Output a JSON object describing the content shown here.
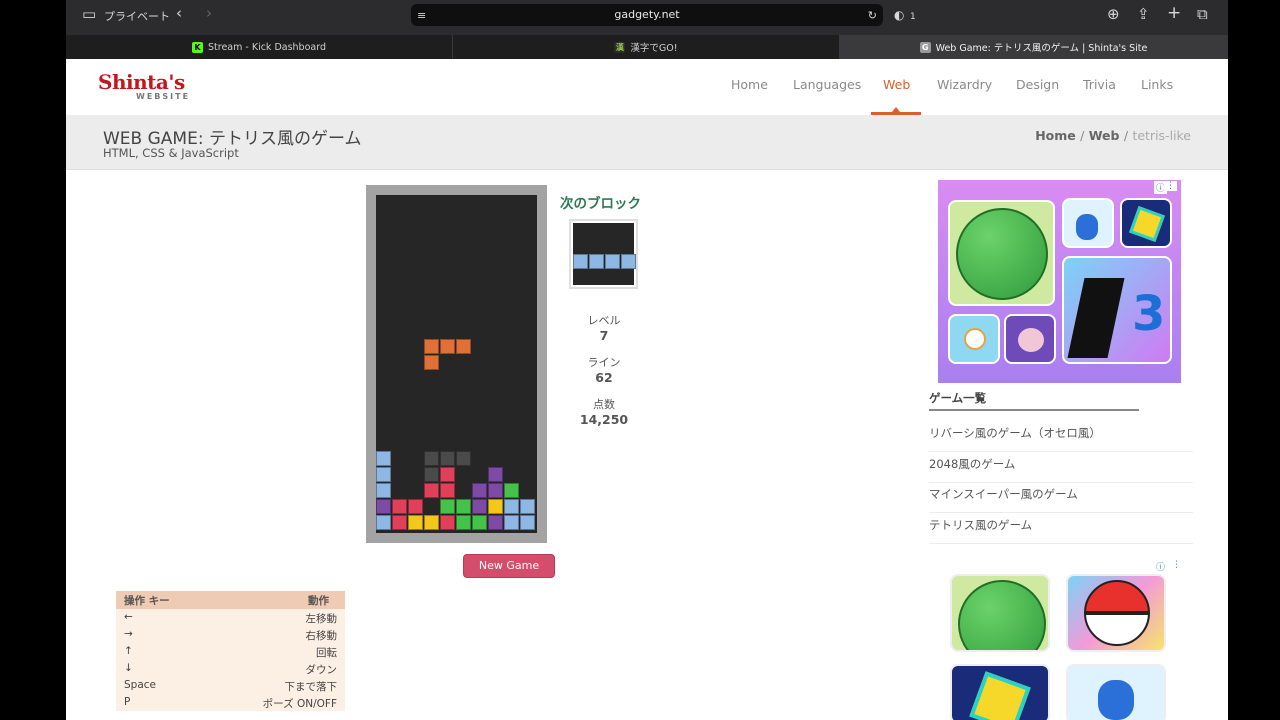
{
  "browser": {
    "private_label": "プライベート",
    "url": "gadgety.net",
    "shield_count": "1",
    "tabs": [
      {
        "title": "Stream - Kick Dashboard",
        "favicon": "K",
        "favicon_color": "#53fc18"
      },
      {
        "title": "漢字でGO!",
        "favicon": "漢",
        "favicon_color": "#9acd32"
      },
      {
        "title": "Web Game: テトリス風のゲーム | Shinta's Site",
        "favicon": "G",
        "favicon_color": "#9a9a9a"
      }
    ]
  },
  "site": {
    "logo_main": "Shinta's",
    "logo_sub": "WEBSITE",
    "nav": [
      "Home",
      "Languages",
      "Web",
      "Wizardry",
      "Design",
      "Trivia",
      "Links"
    ],
    "nav_active": "Web",
    "accent_color": "#d95f2b"
  },
  "page": {
    "title": "WEB GAME: テトリス風のゲーム",
    "subtitle": "HTML, CSS & JavaScript",
    "breadcrumb": {
      "home": "Home",
      "section": "Web",
      "current": "tetris-like",
      "sep": "/"
    }
  },
  "game": {
    "next_label": "次のブロック",
    "level_label": "レベル",
    "level": "7",
    "lines_label": "ライン",
    "lines": "62",
    "score_label": "点数",
    "score": "14,250",
    "new_game_label": "New Game",
    "board_cols": 10,
    "board_rows": 21,
    "falling_piece": {
      "color": "#e07038",
      "cells": [
        [
          3,
          9
        ],
        [
          4,
          9
        ],
        [
          5,
          9
        ],
        [
          3,
          10
        ]
      ]
    },
    "ghost_color": "#4a4a4a",
    "ghost_cells": [
      [
        3,
        16
      ],
      [
        4,
        16
      ],
      [
        5,
        16
      ],
      [
        3,
        17
      ]
    ],
    "stack": [
      {
        "color": "#8fb7e4",
        "cells": [
          [
            0,
            16
          ],
          [
            0,
            17
          ],
          [
            0,
            18
          ],
          [
            0,
            20
          ]
        ]
      },
      {
        "color": "#e0405a",
        "cells": [
          [
            4,
            17
          ],
          [
            3,
            18
          ],
          [
            4,
            18
          ],
          [
            1,
            19
          ],
          [
            2,
            19
          ],
          [
            1,
            20
          ],
          [
            4,
            20
          ]
        ]
      },
      {
        "color": "#7d4aa6",
        "cells": [
          [
            7,
            17
          ],
          [
            6,
            18
          ],
          [
            7,
            18
          ],
          [
            0,
            19
          ],
          [
            6,
            19
          ],
          [
            7,
            20
          ]
        ]
      },
      {
        "color": "#46c24a",
        "cells": [
          [
            8,
            18
          ],
          [
            4,
            19
          ],
          [
            5,
            19
          ],
          [
            5,
            20
          ],
          [
            6,
            20
          ]
        ]
      },
      {
        "color": "#f2c81a",
        "cells": [
          [
            7,
            19
          ],
          [
            2,
            20
          ],
          [
            3,
            20
          ]
        ]
      },
      {
        "color": "#8fb7e4",
        "cells": [
          [
            8,
            19
          ],
          [
            9,
            19
          ],
          [
            8,
            20
          ],
          [
            9,
            20
          ]
        ]
      }
    ],
    "next_piece": {
      "color": "#8fb7e4",
      "cells": [
        [
          0,
          0
        ],
        [
          1,
          0
        ],
        [
          2,
          0
        ],
        [
          3,
          0
        ]
      ]
    }
  },
  "controls": {
    "header_key": "操作  キー",
    "header_action": "動作",
    "rows": [
      {
        "key": "←",
        "action": "左移動"
      },
      {
        "key": "→",
        "action": "右移動"
      },
      {
        "key": "↑",
        "action": "回転"
      },
      {
        "key": "↓",
        "action": "ダウン"
      },
      {
        "key": "Space",
        "action": "下まで落下"
      },
      {
        "key": "P",
        "action": "ポーズ ON/OFF"
      }
    ]
  },
  "sidebar": {
    "games_heading": "ゲーム一覧",
    "games": [
      "リバーシ風のゲーム（オセロ風）",
      "2048風のゲーム",
      "マインスイーパー風のゲーム",
      "テトリス風のゲーム"
    ]
  }
}
